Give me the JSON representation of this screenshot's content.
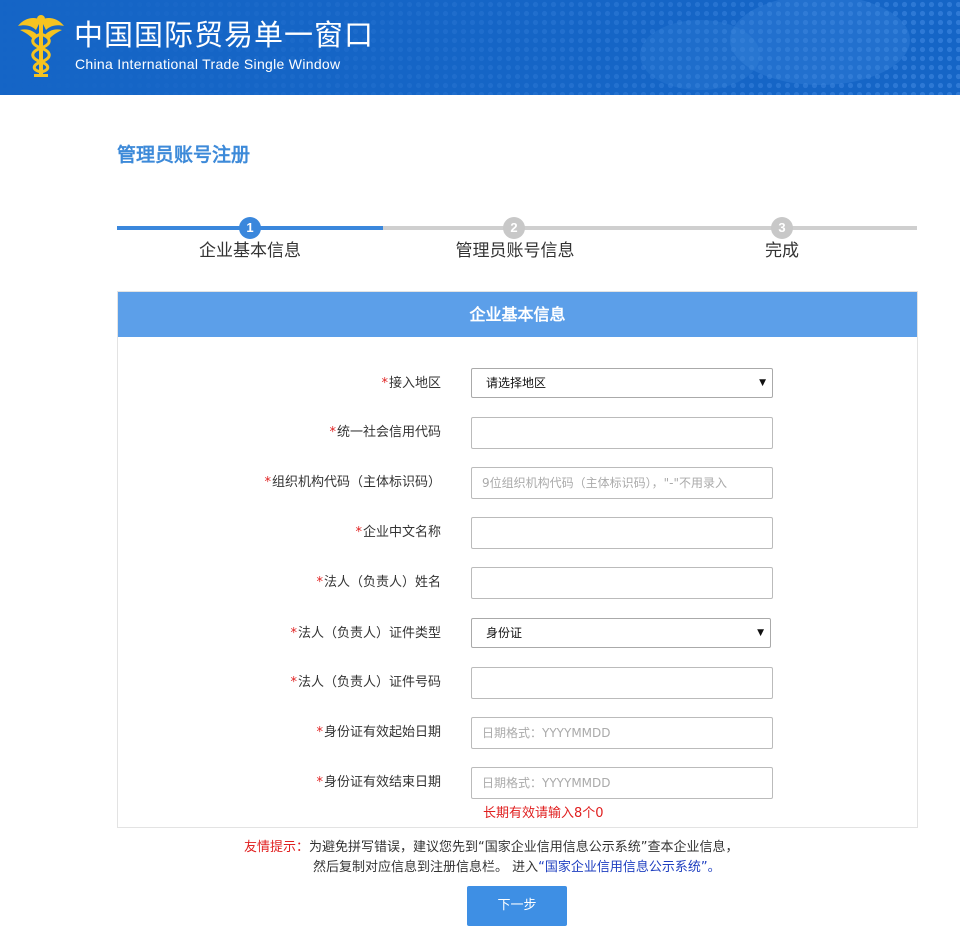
{
  "header": {
    "title": "中国国际贸易单一窗口",
    "subtitle": "China International Trade Single  Window",
    "brand_color": "#1565c6"
  },
  "page": {
    "title": "管理员账号注册"
  },
  "steps": [
    {
      "number": "1",
      "label": "企业基本信息",
      "active": true
    },
    {
      "number": "2",
      "label": "管理员账号信息",
      "active": false
    },
    {
      "number": "3",
      "label": "完成",
      "active": false
    }
  ],
  "panel": {
    "title": "企业基本信息",
    "fields": [
      {
        "label": "接入地区",
        "type": "select",
        "value": "请选择地区"
      },
      {
        "label": "统一社会信用代码",
        "type": "input",
        "placeholder": ""
      },
      {
        "label": "组织机构代码（主体标识码）",
        "type": "input",
        "placeholder": "9位组织机构代码（主体标识码），\"-\"不用录入"
      },
      {
        "label": "企业中文名称",
        "type": "input",
        "placeholder": ""
      },
      {
        "label": "法人（负责人）姓名",
        "type": "input",
        "placeholder": ""
      },
      {
        "label": "法人（负责人）证件类型",
        "type": "select",
        "value": "身份证"
      },
      {
        "label": "法人（负责人）证件号码",
        "type": "input",
        "placeholder": ""
      },
      {
        "label": "身份证有效起始日期",
        "type": "input",
        "placeholder": "日期格式：YYYYMMDD"
      },
      {
        "label": "身份证有效结束日期",
        "type": "input",
        "placeholder": "日期格式：YYYYMMDD"
      }
    ],
    "required_mark": "*",
    "end_date_hint": "长期有效请输入8个0"
  },
  "tips": {
    "prefix": "友情提示：",
    "line1": "为避免拼写错误，建议您先到“国家企业信用信息公示系统”查本企业信息，",
    "line2": "然后复制对应信息到注册信息栏。 进入",
    "link": "“国家企业信用信息公示系统”。"
  },
  "actions": {
    "next_label": "下一步"
  }
}
